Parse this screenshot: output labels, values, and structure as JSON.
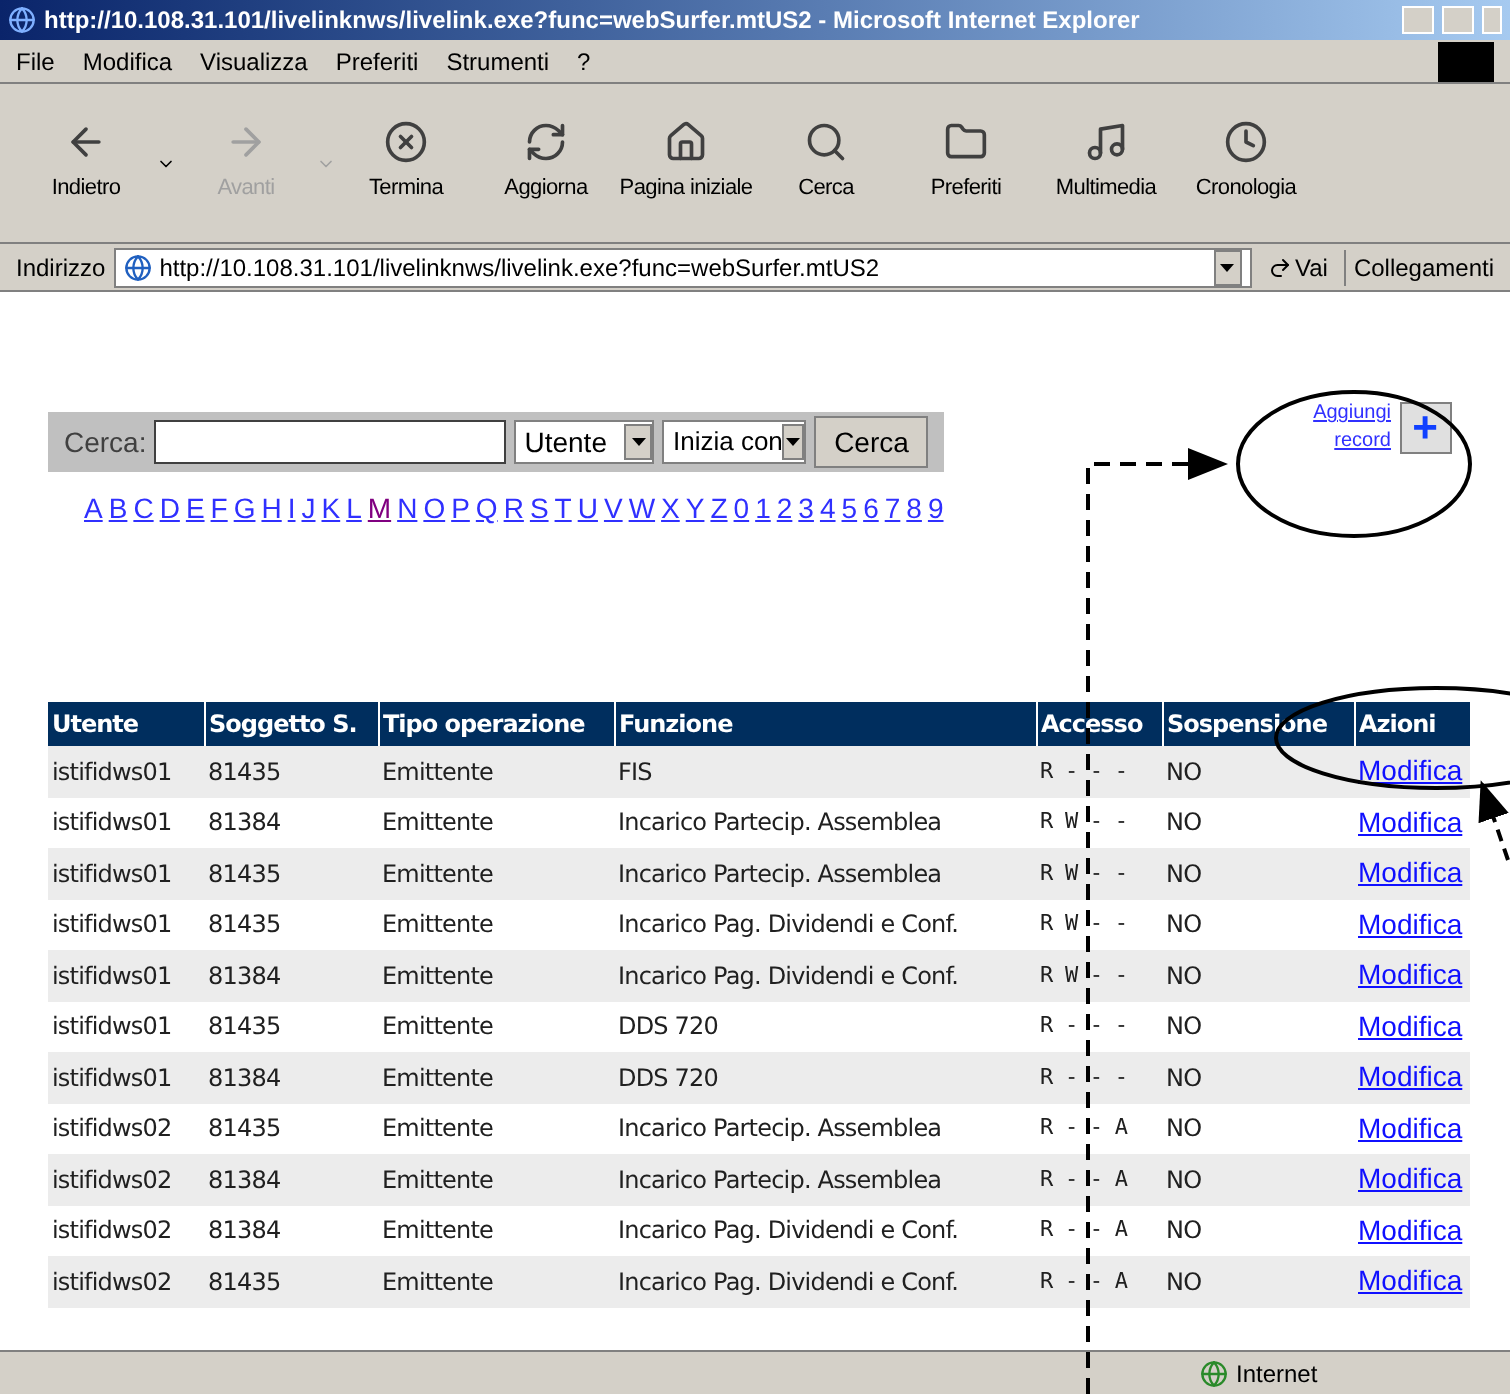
{
  "window": {
    "title": "http://10.108.31.101/livelinknws/livelink.exe?func=webSurfer.mtUS2 - Microsoft Internet Explorer"
  },
  "menu": [
    "File",
    "Modifica",
    "Visualizza",
    "Preferiti",
    "Strumenti",
    "?"
  ],
  "toolbar": [
    {
      "label": "Indietro",
      "kind": "back",
      "disabled": false,
      "dropdown": true
    },
    {
      "label": "Avanti",
      "kind": "forward",
      "disabled": true,
      "dropdown": true
    },
    {
      "label": "Termina",
      "kind": "stop",
      "disabled": false,
      "dropdown": false
    },
    {
      "label": "Aggiorna",
      "kind": "refresh",
      "disabled": false,
      "dropdown": false
    },
    {
      "label": "Pagina iniziale",
      "kind": "home",
      "disabled": false,
      "dropdown": false
    },
    {
      "label": "Cerca",
      "kind": "search",
      "disabled": false,
      "dropdown": false
    },
    {
      "label": "Preferiti",
      "kind": "favorites",
      "disabled": false,
      "dropdown": false
    },
    {
      "label": "Multimedia",
      "kind": "media",
      "disabled": false,
      "dropdown": false
    },
    {
      "label": "Cronologia",
      "kind": "history",
      "disabled": false,
      "dropdown": false
    }
  ],
  "address_bar": {
    "label": "Indirizzo",
    "value": "http://10.108.31.101/livelinknws/livelink.exe?func=webSurfer.mtUS2",
    "go": "Vai",
    "links": "Collegamenti"
  },
  "search": {
    "label": "Cerca:",
    "field_select": "Utente",
    "mode_select": "Inizia con",
    "button": "Cerca"
  },
  "letters": [
    {
      "label": "A",
      "visited": false
    },
    {
      "label": "B",
      "visited": false
    },
    {
      "label": "C",
      "visited": false
    },
    {
      "label": "D",
      "visited": false
    },
    {
      "label": "E",
      "visited": false
    },
    {
      "label": "F",
      "visited": false
    },
    {
      "label": "G",
      "visited": false
    },
    {
      "label": "H",
      "visited": false
    },
    {
      "label": "I",
      "visited": false
    },
    {
      "label": "J",
      "visited": false
    },
    {
      "label": "K",
      "visited": false
    },
    {
      "label": "L",
      "visited": false
    },
    {
      "label": "M",
      "visited": true
    },
    {
      "label": "N",
      "visited": false
    },
    {
      "label": "O",
      "visited": false
    },
    {
      "label": "P",
      "visited": false
    },
    {
      "label": "Q",
      "visited": false
    },
    {
      "label": "R",
      "visited": false
    },
    {
      "label": "S",
      "visited": false
    },
    {
      "label": "T",
      "visited": false
    },
    {
      "label": "U",
      "visited": false
    },
    {
      "label": "V",
      "visited": false
    },
    {
      "label": "W",
      "visited": false
    },
    {
      "label": "X",
      "visited": false
    },
    {
      "label": "Y",
      "visited": false
    },
    {
      "label": "Z",
      "visited": false
    },
    {
      "label": "0",
      "visited": false
    },
    {
      "label": "1",
      "visited": false
    },
    {
      "label": "2",
      "visited": false
    },
    {
      "label": "3",
      "visited": false
    },
    {
      "label": "4",
      "visited": false
    },
    {
      "label": "5",
      "visited": false
    },
    {
      "label": "6",
      "visited": false
    },
    {
      "label": "7",
      "visited": false
    },
    {
      "label": "8",
      "visited": false
    },
    {
      "label": "9",
      "visited": false
    }
  ],
  "add_record": {
    "line_1": "Aggiungi",
    "line_2": "record",
    "button": "+"
  },
  "table": {
    "columns": [
      "Utente",
      "Soggetto S.",
      "Tipo operazione",
      "Funzione",
      "Accesso",
      "Sospensione",
      "Azioni"
    ],
    "rows": [
      [
        "istifidws01",
        "81435",
        "Emittente",
        "FIS",
        "R - - -",
        "NO",
        "Modifica"
      ],
      [
        "istifidws01",
        "81384",
        "Emittente",
        "Incarico Partecip. Assemblea",
        "R W - -",
        "NO",
        "Modifica"
      ],
      [
        "istifidws01",
        "81435",
        "Emittente",
        "Incarico Partecip. Assemblea",
        "R W - -",
        "NO",
        "Modifica"
      ],
      [
        "istifidws01",
        "81435",
        "Emittente",
        "Incarico Pag. Dividendi e Conf.",
        "R W - -",
        "NO",
        "Modifica"
      ],
      [
        "istifidws01",
        "81384",
        "Emittente",
        "Incarico Pag. Dividendi e Conf.",
        "R W - -",
        "NO",
        "Modifica"
      ],
      [
        "istifidws01",
        "81435",
        "Emittente",
        "DDS 720",
        "R - - -",
        "NO",
        "Modifica"
      ],
      [
        "istifidws01",
        "81384",
        "Emittente",
        "DDS 720",
        "R - - -",
        "NO",
        "Modifica"
      ],
      [
        "istifidws02",
        "81435",
        "Emittente",
        "Incarico Partecip. Assemblea",
        "R - - A",
        "NO",
        "Modifica"
      ],
      [
        "istifidws02",
        "81384",
        "Emittente",
        "Incarico Partecip. Assemblea",
        "R - - A",
        "NO",
        "Modifica"
      ],
      [
        "istifidws02",
        "81384",
        "Emittente",
        "Incarico Pag. Dividendi e Conf.",
        "R - - A",
        "NO",
        "Modifica"
      ],
      [
        "istifidws02",
        "81435",
        "Emittente",
        "Incarico Pag. Dividendi e Conf.",
        "R - - A",
        "NO",
        "Modifica"
      ]
    ]
  },
  "status_bar": {
    "zone": "Internet"
  }
}
